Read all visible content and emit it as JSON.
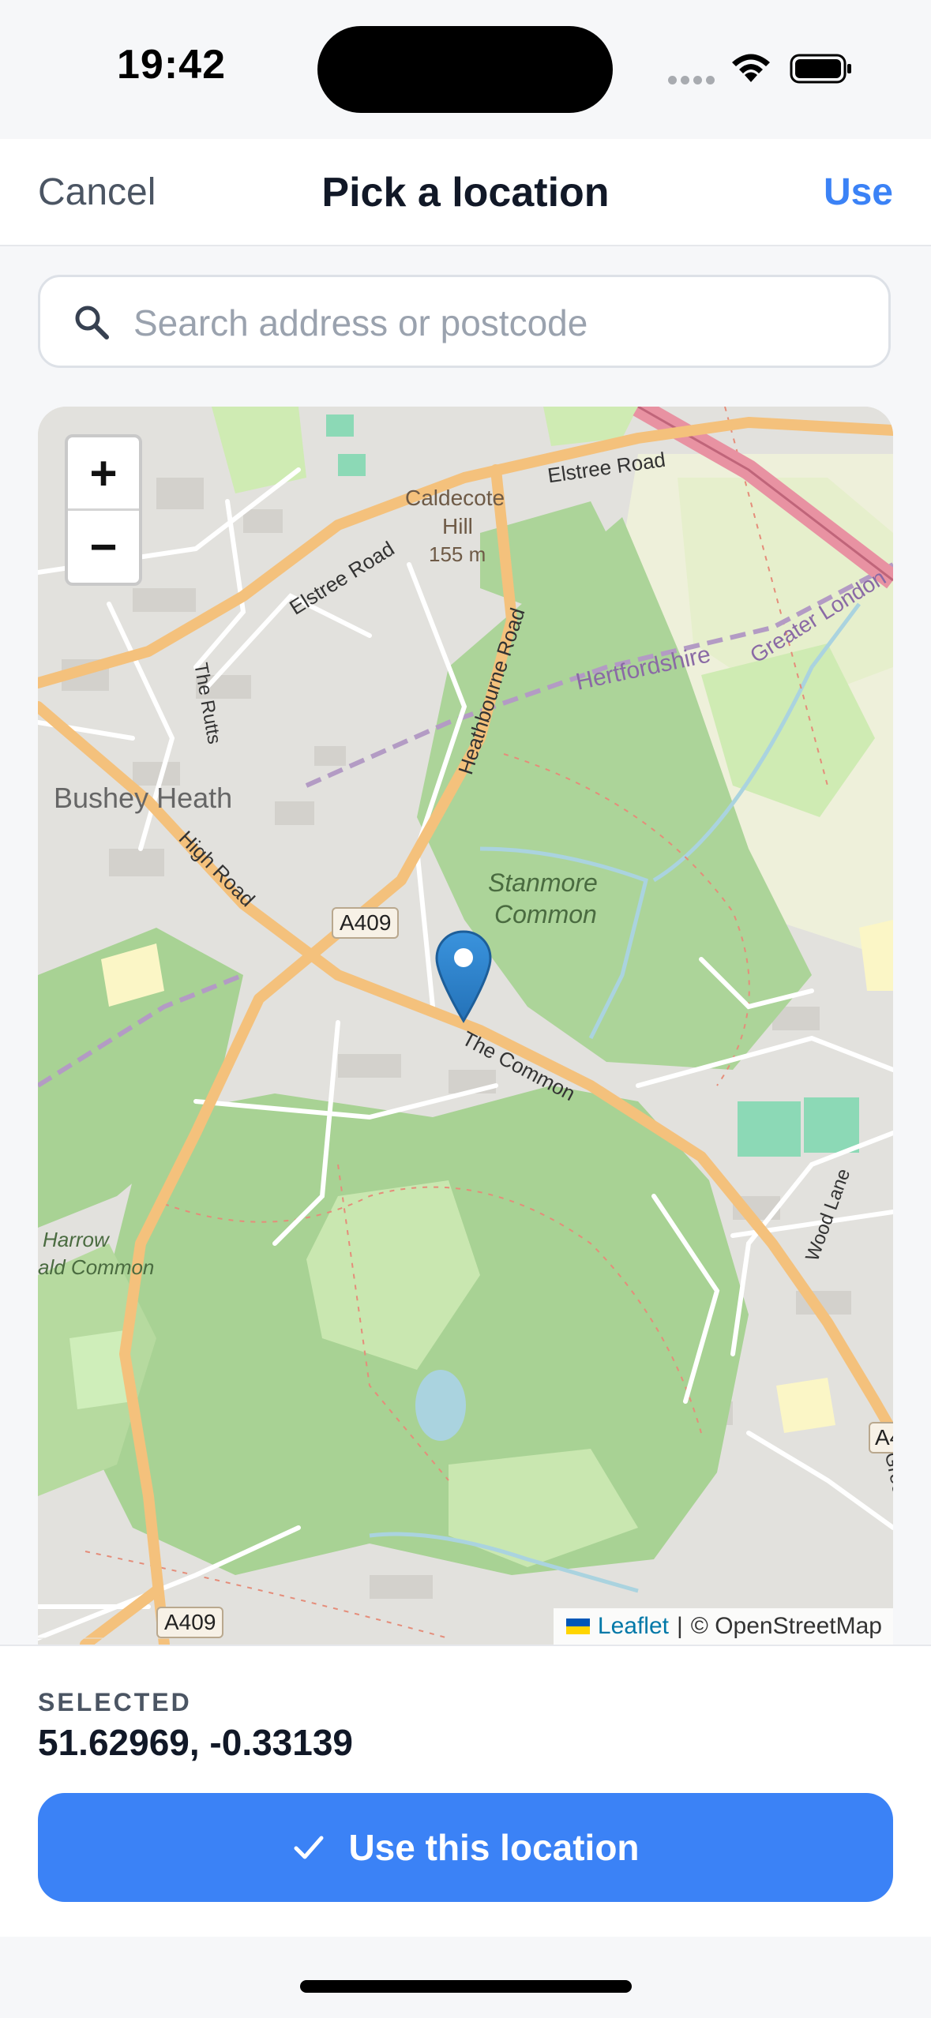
{
  "status_bar": {
    "time": "19:42"
  },
  "nav": {
    "cancel_label": "Cancel",
    "title": "Pick a location",
    "use_label": "Use"
  },
  "search": {
    "placeholder": "Search address or postcode",
    "value": ""
  },
  "map": {
    "zoom_in_label": "+",
    "zoom_out_label": "−",
    "labels": {
      "caldecote": "Caldecote",
      "hill": "Hill",
      "elevation": "155 m",
      "elstree_road_1": "Elstree Road",
      "elstree_road_2": "Elstree Road",
      "heathbourne": "Heathbourne Road",
      "hertfordshire": "Hertfordshire",
      "greater_london": "Greater London",
      "the_rutts": "The Rutts",
      "bushey_heath": "Bushey Heath",
      "high_road": "High Road",
      "stanmore": "Stanmore",
      "common": "Common",
      "a409_top": "A409",
      "the_common": "The Common",
      "harrow": "Harrow",
      "weald_common": "ald Common",
      "wood_lane": "Wood Lane",
      "green_lane": "Green La",
      "a409_bottom": "A409",
      "a_edge": "A4"
    },
    "attribution": {
      "leaflet": "Leaflet",
      "separator": "|",
      "osm": "© OpenStreetMap"
    }
  },
  "selected": {
    "label": "SELECTED",
    "value": "51.62969, -0.33139"
  },
  "use_button": {
    "label": "Use this location"
  },
  "colors": {
    "accent": "#3b82f6",
    "woodland": "#a8d294",
    "road": "#f4c17c",
    "motorway": "#e892a2",
    "park": "#cfebb3",
    "urban": "#e0dfdb"
  }
}
